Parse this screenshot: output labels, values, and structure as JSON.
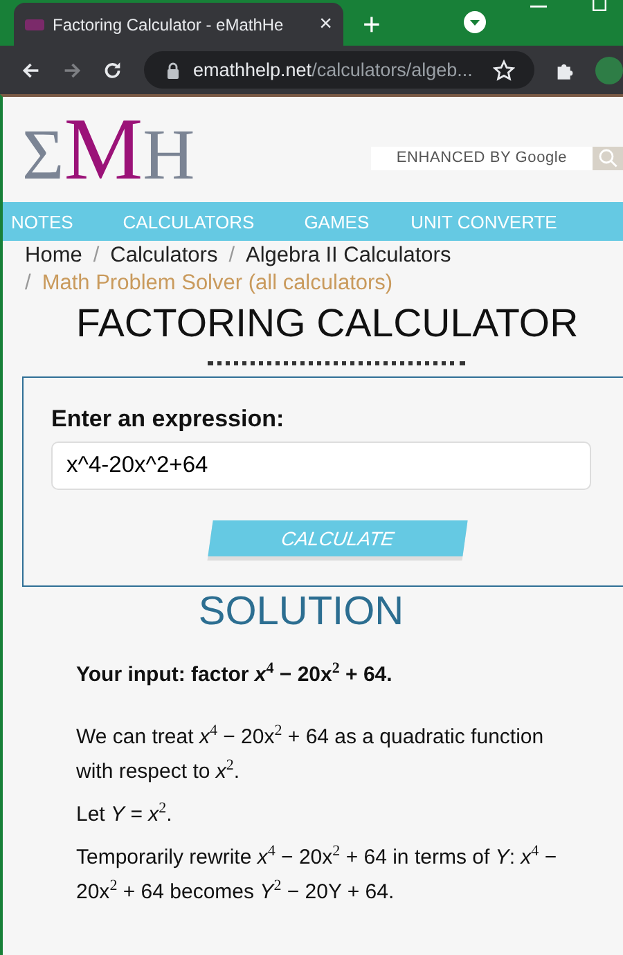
{
  "browser": {
    "tab_title": "Factoring Calculator - eMathHe",
    "tab_close": "×",
    "new_tab": "+",
    "url_host": "emathhelp.net",
    "url_path": "/calculators/algeb..."
  },
  "logo": {
    "sigma": "Σ",
    "m": "M",
    "h": "H"
  },
  "search": {
    "placeholder": "ENHANCED BY Google"
  },
  "nav": [
    {
      "label": "NOTES"
    },
    {
      "label": "CALCULATORS"
    },
    {
      "label": "GAMES"
    },
    {
      "label": "UNIT CONVERTE"
    }
  ],
  "breadcrumbs": [
    {
      "label": "Home",
      "kind": "link"
    },
    {
      "separator": "/",
      "label": "Calculators",
      "kind": "link"
    },
    {
      "separator": "/",
      "label": "Algebra II Calculators",
      "kind": "link"
    },
    {
      "separator": "/",
      "label": "Math Problem Solver (all calculators)",
      "kind": "accent"
    }
  ],
  "title": "FACTORING CALCULATOR",
  "form": {
    "label": "Enter an expression:",
    "value": "x^4-20x^2+64",
    "button": "CALCULATE"
  },
  "solution": {
    "heading": "SOLUTION",
    "paragraphs": [
      "**Your input: factor** *x*$^{4}$ − 20x$^{2}$ + 64**.**",
      "We can treat *x*$^{4}$ − 20x$^{2}$ + 64 as a quadratic function with respect to *x*$^{2}$.",
      "Let *Y* = *x*$^{2}$.",
      "Temporarily rewrite *x*$^{4}$ − 20x$^{2}$ + 64 in terms of *Y*: *x*$^{4}$ − 20x$^{2}$ + 64 becomes *Y*$^{2}$ − 20Y + 64."
    ]
  }
}
